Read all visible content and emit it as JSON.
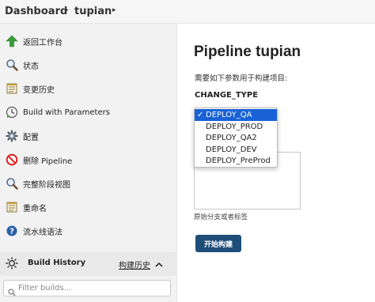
{
  "breadcrumb": {
    "items": [
      {
        "label": "Dashboard"
      },
      {
        "label": "tupian"
      }
    ]
  },
  "sidebar": {
    "items": [
      {
        "label": "返回工作台",
        "icon": "up-arrow-icon"
      },
      {
        "label": "状态",
        "icon": "magnifier-icon"
      },
      {
        "label": "变更历史",
        "icon": "notepad-icon"
      },
      {
        "label": "Build with Parameters",
        "icon": "clock-play-icon"
      },
      {
        "label": "配置",
        "icon": "gear-icon"
      },
      {
        "label": "删除 Pipeline",
        "icon": "no-entry-icon"
      },
      {
        "label": "完整阶段视图",
        "icon": "magnifier-icon"
      },
      {
        "label": "重命名",
        "icon": "notepad-icon"
      },
      {
        "label": "流水线语法",
        "icon": "help-icon"
      }
    ],
    "build_history": {
      "title": "Build History",
      "link": "构建历史"
    },
    "filter": {
      "placeholder": "Filter builds..."
    }
  },
  "main": {
    "title": "Pipeline tupian",
    "subtitle": "需要如下参数用于构建项目:",
    "param_name": "CHANGE_TYPE",
    "options": [
      "DEPLOY_QA",
      "DEPLOY_PROD",
      "DEPLOY_QA2",
      "DEPLOY_DEV",
      "DEPLOY_PreProd"
    ],
    "selected_option": "DEPLOY_QA",
    "selected_mark": "✓",
    "textarea_caption": "原始分支或者标签",
    "build_button": "开始构建"
  },
  "colors": {
    "accent": "#1f4e79",
    "selection": "#1862d6"
  }
}
